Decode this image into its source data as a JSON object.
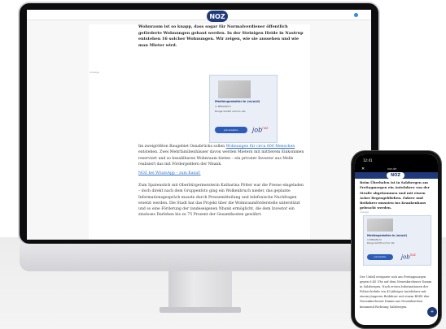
{
  "brand": {
    "logo_text": "NOZ",
    "accent": "#1e3a7b"
  },
  "article": {
    "lead": "Wohnraum ist so knapp, dass sogar für Normalverdiener öffentlich geförderte Wohnungen gebaut werden. In der Steinigen Heide in Nastrup entstehen 16 solcher Wohnungen. Wir zeigen, wie sie aussehen und wie man Mieter wird.",
    "ad_label": "Anzeige",
    "ad": {
      "title": "Mediengestalter:in (m/w/d)",
      "subtitle": "in Mitte/Nord",
      "company": "Runge GmbH und Co. KG",
      "button": "Job ansehen",
      "brand": "job",
      "brand_sup": "noz"
    },
    "para1_pre": "Im zweigrößten Baugebiet Osnabrücks sollen ",
    "para1_link": "Wohnungen für circa 600 Menschen",
    "para1_post": " entstehen. Zwei Mehrfamilienhäuser davon werden Mietern mit mittlerem Einkommen reserviert und so bezahlbaren Wohnraum bieten – ein privater Investor aus Melle realisiert das mit Fördergeldern der Nbank.",
    "whatsapp_link": "NOZ bei WhatsApp – zum Kanal!",
    "para2": "Zum Spatenstich mit Oberbürgermeisterin Katharina Pötter war die Presse eingeladen – doch direkt nach dem Gruppenfoto ging ein Wolkenbruch nieder, das geplante Informationsgespräch musste durch Pressemitteilung und telefonische Nachfragen ersetzt werden. Die Stadt hat das Projekt über die Wohnraumförderstelle unterstützt und so eine Förderung der landeseigenen Nbank ermöglicht, die dem Investor ein zinsloses Darlehen bis zu 75 Prozent der Gesamtkosten gewährt."
  },
  "phone": {
    "time": "12:41",
    "url": "noz.de",
    "close": "✕",
    "lead": "Beim Überholen ist in Salzbergen am Freitagmorgen ein Autofahrer von der Straße abgekommen und mit einem Acker liegengeblieben. Fahrer und Beifahrer mussten ins Krankenhaus gebracht werden.",
    "ad_label": "Anzeige",
    "para": "Der Unfall ereignete sich am Freitagmorgen gegen 6:45 Uhr auf dem Neuenkirchener Damm in Salzbergen. Nach ersten Informationen der Polizei befuhr ein 43-jähriger Autofahrer mit einem jüngeren Beifahrer mit einem BMW den Neuenkirchener Damm aus Neuenkirchen kommend Richtung Salzbergen.",
    "fab_label": "+"
  }
}
